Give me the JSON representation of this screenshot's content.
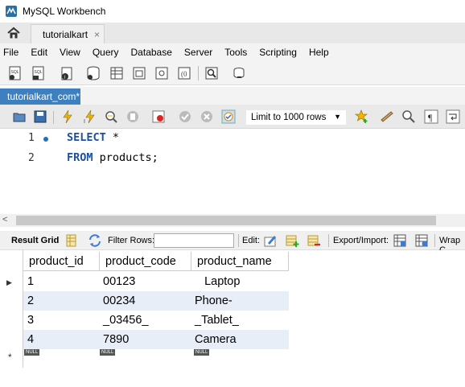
{
  "window": {
    "title": "MySQL Workbench"
  },
  "connection_tab": {
    "label": "tutorialkart",
    "close": "×"
  },
  "menu": [
    "File",
    "Edit",
    "View",
    "Query",
    "Database",
    "Server",
    "Tools",
    "Scripting",
    "Help"
  ],
  "editor_tab": {
    "label": "tutorialkart_com*"
  },
  "sql_toolbar": {
    "limit_label": "Limit to 1000 rows"
  },
  "editor": {
    "lines": [
      {
        "num": "1",
        "keyword": "SELECT",
        "rest": " *"
      },
      {
        "num": "2",
        "keyword": "FROM",
        "rest": " products;"
      }
    ]
  },
  "result_toolbar": {
    "result_grid": "Result Grid",
    "filter_rows": "Filter Rows:",
    "edit": "Edit:",
    "export_import": "Export/Import:",
    "wrap": "Wrap C"
  },
  "grid": {
    "columns": [
      "product_id",
      "product_code",
      "product_name"
    ],
    "rows": [
      [
        "1",
        "00123",
        "   Laptop"
      ],
      [
        "2",
        "00234",
        "Phone-"
      ],
      [
        "3",
        "_03456_",
        "_Tablet_"
      ],
      [
        "4",
        "7890",
        "Camera"
      ]
    ],
    "null_label": "NULL",
    "new_row_marker": "*",
    "current_row_marker": "▶"
  },
  "colors": {
    "accent": "#3e7fbf",
    "keyword": "#1b4fa0",
    "alt_row": "#e8eef8"
  }
}
